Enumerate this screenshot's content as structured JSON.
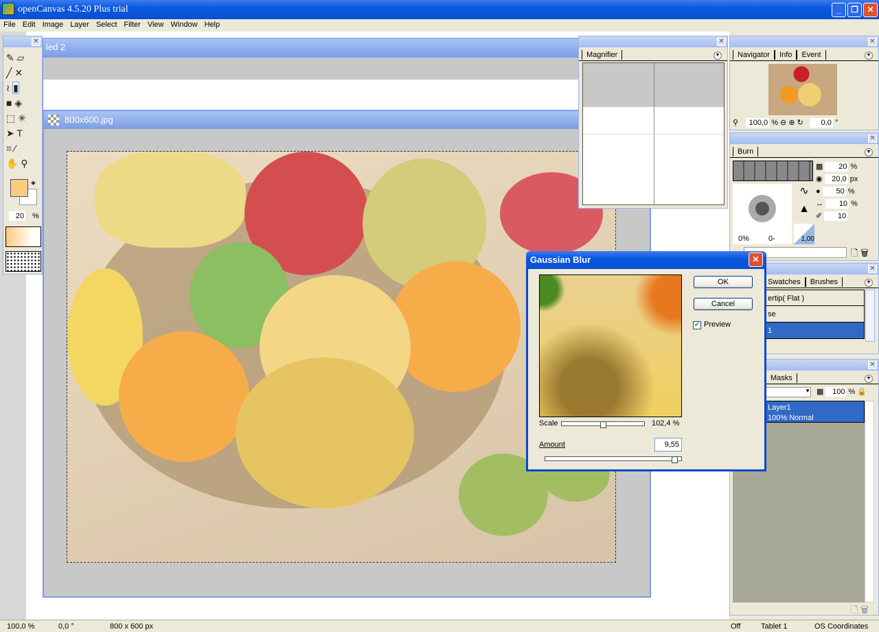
{
  "app": {
    "title": "openCanvas 4.5.20 Plus trial",
    "minimize": "_",
    "maximize": "❐",
    "close": "✕"
  },
  "menu": [
    "File",
    "Edit",
    "Image",
    "Layer",
    "Select",
    "Filter",
    "View",
    "Window",
    "Help"
  ],
  "windows": {
    "back_title": "led 2",
    "front_title": "800x600.jpg"
  },
  "toolbox": {
    "brush_size": "20",
    "unit": "%",
    "colors": {
      "foreground": "#fdcb80",
      "background": "#ffffff"
    }
  },
  "magnifier": {
    "tab": "Magnifier"
  },
  "navigator": {
    "tabs": [
      "Navigator",
      "Info",
      "Event"
    ],
    "zoom": "100,0",
    "zoom_unit": "%",
    "rotation": "0,0",
    "rotation_unit": "°"
  },
  "burn": {
    "tab": "Burn",
    "rows": [
      {
        "value": "20",
        "unit": "%"
      },
      {
        "value": "20,0",
        "unit": "px"
      },
      {
        "value": "50",
        "unit": "%"
      },
      {
        "value": "10",
        "unit": "%"
      },
      {
        "value": "10",
        "unit": ""
      }
    ],
    "preview_left": "0%",
    "preview_right": "0-",
    "curve_value": "1,00"
  },
  "brushes": {
    "tabs": [
      "Swatches",
      "Brushes"
    ],
    "items": [
      "ertip( Flat )",
      "se",
      "1"
    ],
    "selected": 2
  },
  "layers": {
    "tabs": [
      "Masks"
    ],
    "opacity": "100",
    "unit": "%",
    "layer_name": "Layer1",
    "layer_info": "100% Normal"
  },
  "dialog": {
    "title": "Gaussian Blur",
    "ok": "OK",
    "cancel": "Cancel",
    "preview_label": "Preview",
    "preview_checked": true,
    "scale_label": "Scale",
    "scale_value": "102,4 %",
    "scale_fraction": 0.5,
    "amount_label": "Amount",
    "amount_value": "9,55",
    "amount_fraction": 0.97
  },
  "status": {
    "zoom": "100,0 %",
    "angle": "0,0 °",
    "size": "800 x 600 px",
    "off": "Off",
    "tablet": "Tablet 1",
    "coords": "OS Coordinates"
  }
}
